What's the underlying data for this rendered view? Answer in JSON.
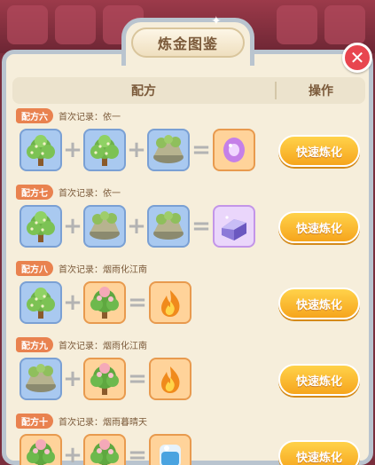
{
  "window": {
    "title": "炼金图鉴",
    "close_icon": "close-icon"
  },
  "table": {
    "header_recipe": "配方",
    "header_action": "操作"
  },
  "recipes": [
    {
      "tag": "配方六",
      "record": "首次记录：依一",
      "ingredients": [
        "tree-icon",
        "tree-icon",
        "rock-icon"
      ],
      "result": "purple-gem-icon",
      "result_bg": "orange",
      "button": "快速炼化"
    },
    {
      "tag": "配方七",
      "record": "首次记录：依一",
      "ingredients": [
        "tree-icon",
        "rock-icon",
        "rock-icon"
      ],
      "result": "crystal-icon",
      "result_bg": "purple",
      "button": "快速炼化"
    },
    {
      "tag": "配方八",
      "record": "首次记录：烟雨化江南",
      "ingredients": [
        "tree-icon",
        "peach-tree-icon"
      ],
      "result": "fire-icon",
      "result_bg": "orange",
      "button": "快速炼化"
    },
    {
      "tag": "配方九",
      "record": "首次记录：烟雨化江南",
      "ingredients": [
        "rock-icon",
        "peach-tree-icon"
      ],
      "result": "fire-icon",
      "result_bg": "orange",
      "button": "快速炼化"
    },
    {
      "tag": "配方十",
      "record": "首次记录：烟雨暮晴天",
      "ingredients": [
        "peach-tree-icon",
        "peach-tree-icon"
      ],
      "result": "water-icon",
      "result_bg": "orange",
      "button": "快速炼化"
    }
  ],
  "colors": {
    "accent_button": "#f6a51d",
    "tag": "#e9824f",
    "close": "#e8454f"
  }
}
